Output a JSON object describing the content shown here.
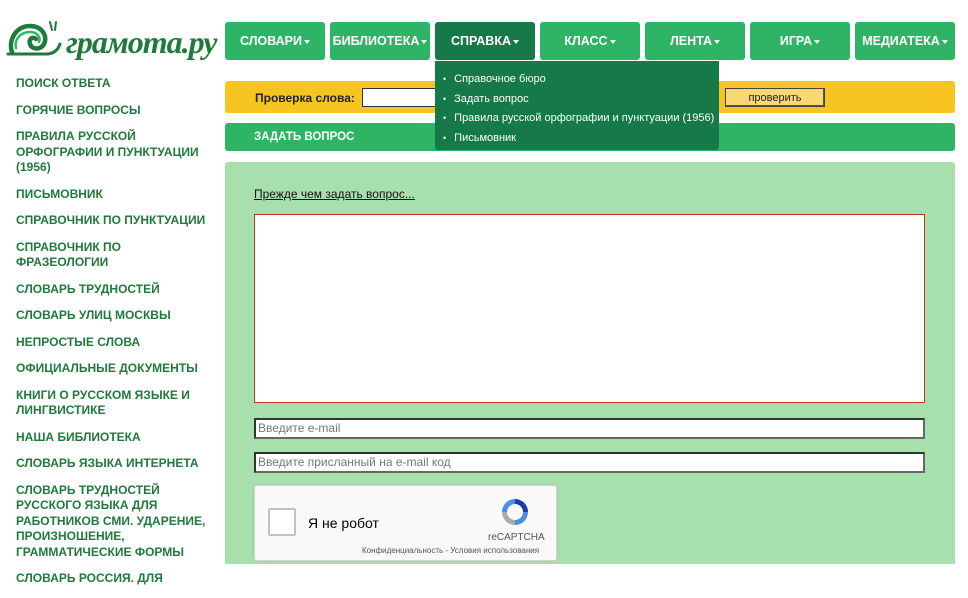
{
  "logo": {
    "text": "грамота.ру"
  },
  "sidebar": {
    "items": [
      "ПОИСК ОТВЕТА",
      "ГОРЯЧИЕ ВОПРОСЫ",
      "ПРАВИЛА РУССКОЙ ОРФОГРАФИИ И ПУНКТУАЦИИ (1956)",
      "ПИСЬМОВНИК",
      "СПРАВОЧНИК ПО ПУНКТУАЦИИ",
      "СПРАВОЧНИК ПО ФРАЗЕОЛОГИИ",
      "СЛОВАРЬ ТРУДНОСТЕЙ",
      "СЛОВАРЬ УЛИЦ МОСКВЫ",
      "НЕПРОСТЫЕ СЛОВА",
      "ОФИЦИАЛЬНЫЕ ДОКУМЕНТЫ",
      "КНИГИ О РУССКОМ ЯЗЫКЕ И ЛИНГВИСТИКЕ",
      "НАША БИБЛИОТЕКА",
      "СЛОВАРЬ ЯЗЫКА ИНТЕРНЕТА",
      "СЛОВАРЬ ТРУДНОСТЕЙ РУССКОГО ЯЗЫКА ДЛЯ РАБОТНИКОВ СМИ. УДАРЕНИЕ, ПРОИЗНОШЕНИЕ, ГРАММАТИЧЕСКИЕ ФОРМЫ",
      "СЛОВАРЬ РОССИЯ. ДЛЯ"
    ]
  },
  "nav": {
    "items": [
      "СЛОВАРИ",
      "БИБЛИОТЕКА",
      "СПРАВКА",
      "КЛАСС",
      "ЛЕНТА",
      "ИГРА",
      "МЕДИАТЕКА"
    ],
    "active": "СПРАВКА"
  },
  "dropdown": {
    "items": [
      "Справочное бюро",
      "Задать вопрос",
      "Правила русской орфографии и пунктуации (1956)",
      "Письмовник"
    ]
  },
  "check": {
    "label": "Проверка слова:",
    "value": "",
    "button": "проверить"
  },
  "ask": {
    "title": "ЗАДАТЬ ВОПРОС",
    "before_link": "Прежде чем задать вопрос...",
    "question_value": "",
    "email_placeholder": "Введите e-mail",
    "code_placeholder": "Введите присланный на e-mail код"
  },
  "recaptcha": {
    "label": "Я не робот",
    "brand": "reCAPTCHA",
    "terms": "Конфиденциальность - Условия использования"
  },
  "colors": {
    "nav_green": "#2db565",
    "nav_active": "#157a47",
    "check_yellow": "#f7c522",
    "panel_green": "#a8e0ad",
    "text_green": "#1f7a3c"
  }
}
